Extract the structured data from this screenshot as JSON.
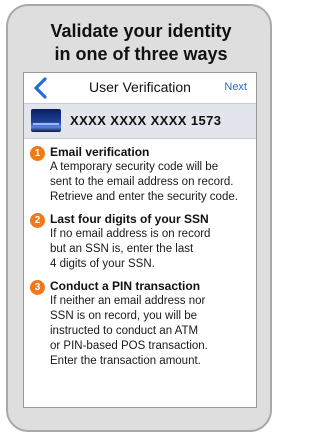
{
  "headline": {
    "line1": "Validate your identity",
    "line2": "in one of three ways"
  },
  "navbar": {
    "back_icon": "chevron-left-icon",
    "title": "User Verification",
    "next_label": "Next"
  },
  "card": {
    "icon": "credit-card-icon",
    "masked_number": "XXXX XXXX XXXX 1573"
  },
  "steps": [
    {
      "number": "1",
      "title": "Email verification",
      "lines": [
        "A temporary security code will be",
        "sent to the email address on record.",
        "Retrieve and enter the security code."
      ]
    },
    {
      "number": "2",
      "title": "Last four digits of your SSN",
      "lines": [
        "If no email address is on record",
        "but an SSN is, enter the last",
        "4 digits of your SSN."
      ]
    },
    {
      "number": "3",
      "title": "Conduct a PIN transaction",
      "lines": [
        "If neither an email address nor",
        "SSN is on record, you will be",
        "instructed to conduct an ATM",
        "or PIN-based POS transaction.",
        "Enter the transaction amount."
      ]
    }
  ],
  "colors": {
    "accent_blue": "#1f6fd6",
    "step_badge_orange": "#ef7a1e",
    "card_row_bg": "#e2e6ec",
    "phone_frame": "#dedede"
  }
}
